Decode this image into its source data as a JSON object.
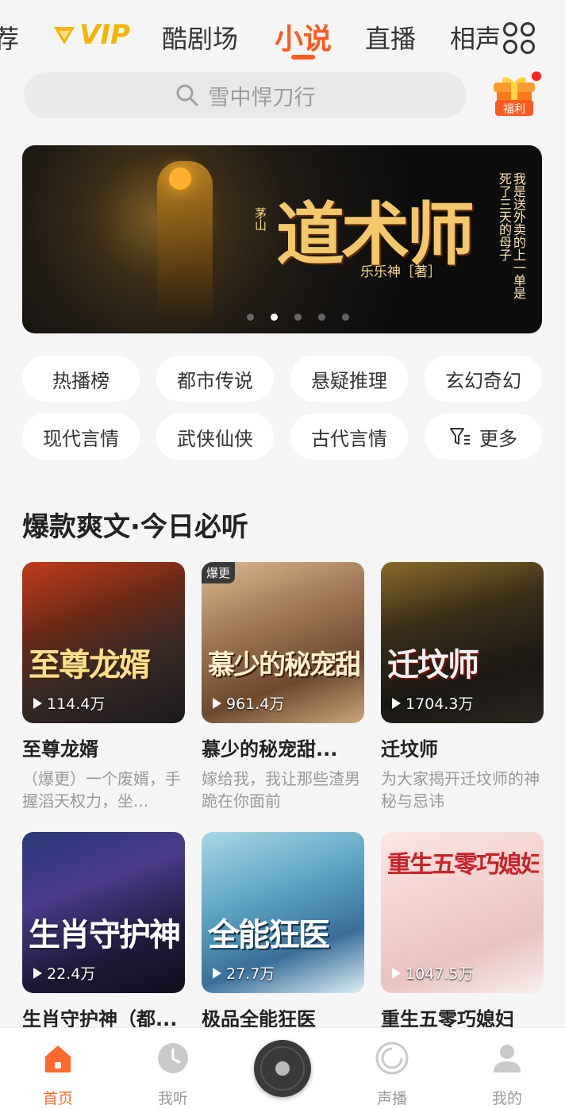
{
  "nav": {
    "tabs": [
      {
        "label": "荐"
      },
      {
        "label": "VIP"
      },
      {
        "label": "酷剧场"
      },
      {
        "label": "小说"
      },
      {
        "label": "直播"
      },
      {
        "label": "相声"
      }
    ],
    "active_tab": "小说",
    "accent_color": "#ff5a1f"
  },
  "search": {
    "placeholder": "雪中悍刀行"
  },
  "gift": {
    "label": "福利"
  },
  "banner": {
    "title": "道术师",
    "subtitle": "茅山",
    "author": "乐乐神［著］",
    "tagline": "我是送外卖的上一单是死了三天的母子",
    "slide_index": 2,
    "slide_count": 5
  },
  "categories": [
    "热播榜",
    "都市传说",
    "悬疑推理",
    "玄幻奇幻",
    "现代言情",
    "武侠仙侠",
    "古代言情",
    "更多"
  ],
  "section": {
    "title": "爆款爽文·今日必听"
  },
  "books": [
    {
      "cover_title": "至尊龙婿",
      "plays": "114.4万",
      "name": "至尊龙婿",
      "desc": "（爆更）一个废婿，手握滔天权力，坐...",
      "badge": ""
    },
    {
      "cover_title": "慕少的秘宠甜妻",
      "plays": "961.4万",
      "name": "慕少的秘宠甜...",
      "desc": "嫁给我，我让那些渣男跪在你面前",
      "badge": "爆更"
    },
    {
      "cover_title": "迁坟师",
      "plays": "1704.3万",
      "name": "迁坟师",
      "desc": "为大家揭开迁坟师的神秘与忌讳",
      "badge": ""
    },
    {
      "cover_title": "生肖守护神",
      "plays": "22.4万",
      "name": "生肖守护神（都...",
      "desc": "",
      "badge": ""
    },
    {
      "cover_title": "全能狂医",
      "plays": "27.7万",
      "name": "极品全能狂医",
      "desc": "",
      "badge": ""
    },
    {
      "cover_title": "重生五零巧媳妇",
      "plays": "1047.5万",
      "name": "重生五零巧媳妇",
      "desc": "",
      "badge": ""
    }
  ],
  "bottom_nav": [
    {
      "label": "首页",
      "icon": "home-icon",
      "active": true
    },
    {
      "label": "我听",
      "icon": "clock-icon",
      "active": false
    },
    {
      "label": "",
      "icon": "player-disc-icon",
      "active": false
    },
    {
      "label": "声播",
      "icon": "broadcast-icon",
      "active": false
    },
    {
      "label": "我的",
      "icon": "profile-icon",
      "active": false
    }
  ]
}
